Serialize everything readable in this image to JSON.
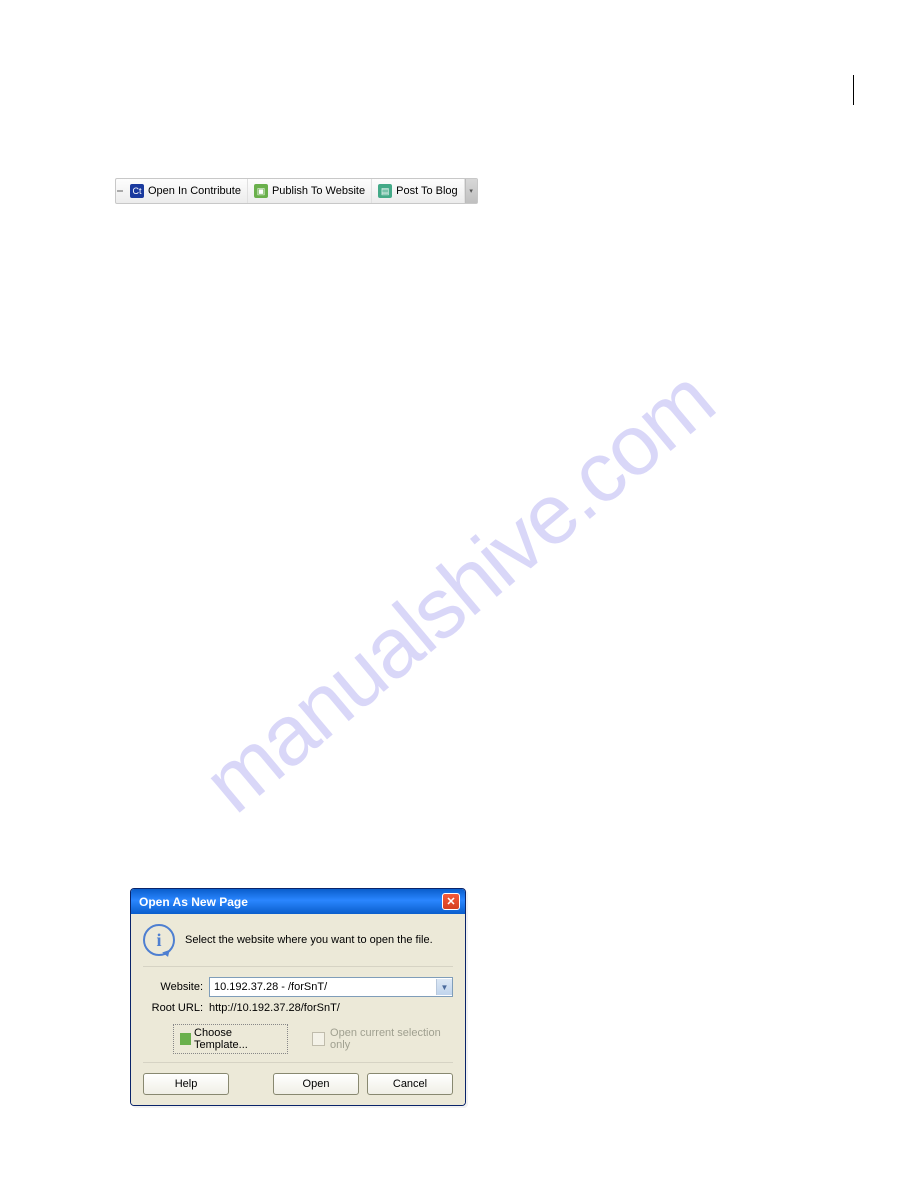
{
  "watermark": "manualshive.com",
  "toolbar": {
    "items": [
      {
        "label": "Open In Contribute",
        "icon": "ct"
      },
      {
        "label": "Publish To Website",
        "icon": "pub"
      },
      {
        "label": "Post To Blog",
        "icon": "blog"
      }
    ]
  },
  "dialog": {
    "title": "Open As New Page",
    "info_text": "Select the website where you want to open the file.",
    "website_label": "Website:",
    "website_value": "10.192.37.28 - /forSnT/",
    "root_url_label": "Root URL:",
    "root_url_value": "http://10.192.37.28/forSnT/",
    "choose_template": "Choose Template...",
    "checkbox_label": "Open current selection only",
    "buttons": {
      "help": "Help",
      "open": "Open",
      "cancel": "Cancel"
    }
  }
}
